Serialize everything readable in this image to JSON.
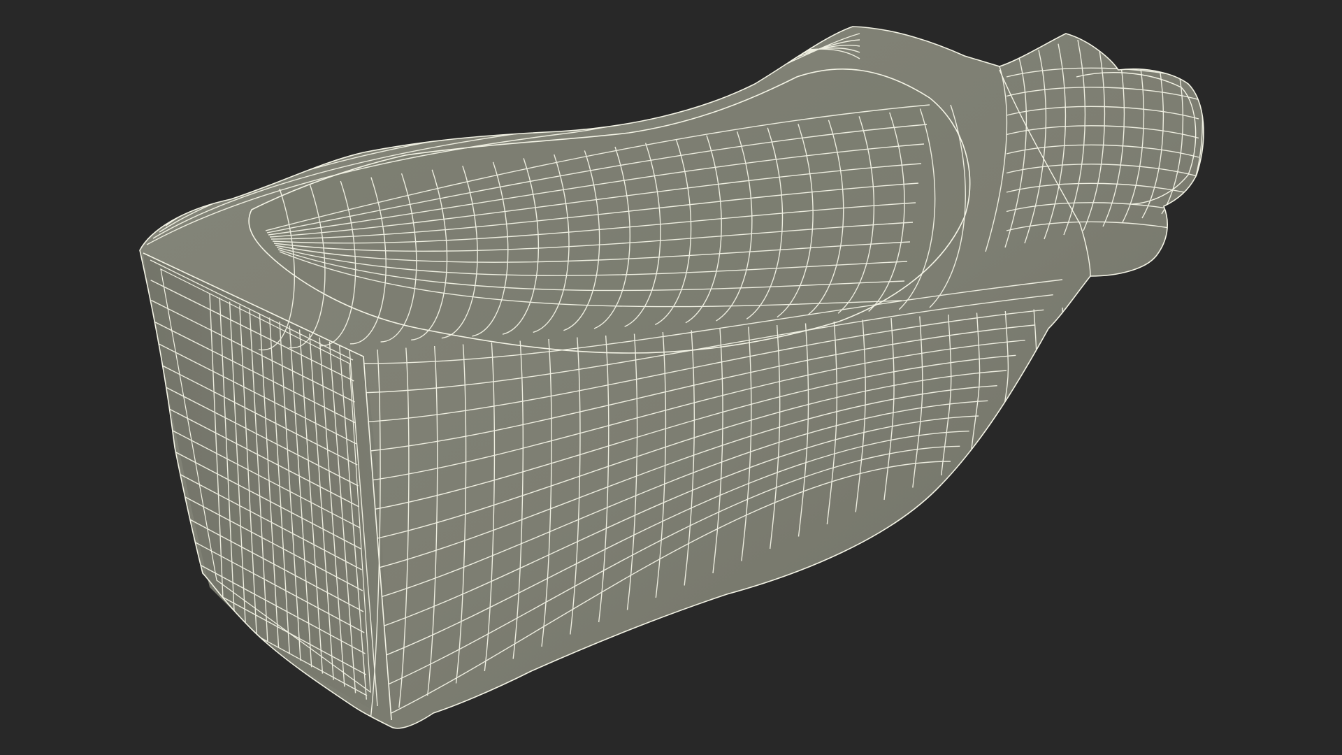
{
  "scene": {
    "background_color": "#282828",
    "mesh_fill_color": "#7d7e72",
    "mesh_shade_color": "#6c6d62",
    "wire_color": "#f4f4e6",
    "object": "wireframe-3d-model"
  }
}
